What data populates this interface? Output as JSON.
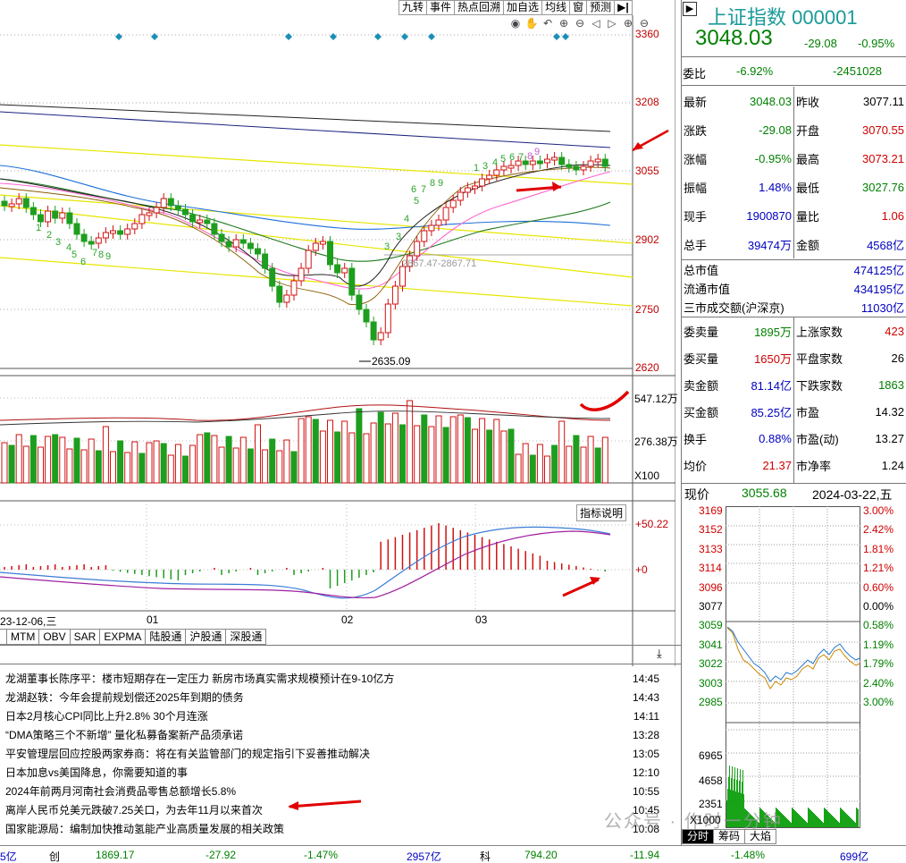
{
  "toolbar": [
    "九转",
    "事件",
    "热点回溯",
    "加自选",
    "均线",
    "窗",
    "预测"
  ],
  "price_axis": [
    "3360",
    "3208",
    "3055",
    "2902",
    "2750",
    "2620"
  ],
  "annotations": {
    "mid_label": "2867.47-2867.71",
    "low_label": "2635.09"
  },
  "volume_axis": {
    "top": "547.12万",
    "mid": "276.38万",
    "unit": "X100"
  },
  "macd": {
    "button": "指标说明",
    "top": "+50.22",
    "zero": "+0"
  },
  "date_axis": {
    "first": "23-12-06,三",
    "months": [
      "01",
      "02",
      "03"
    ]
  },
  "indicator_tabs": [
    "MTM",
    "OBV",
    "SAR",
    "EXPMA",
    "陆股通",
    "沪股通",
    "深股通"
  ],
  "news": [
    {
      "text": "龙湖董事长陈序平：楼市短期存在一定压力 新房市场真实需求规模预计在9-10亿方",
      "time": "14:45"
    },
    {
      "text": "龙湖赵轶：今年会提前规划偿还2025年到期的债务",
      "time": "14:43"
    },
    {
      "text": "日本2月核心CPI同比上升2.8% 30个月连涨",
      "time": "14:11"
    },
    {
      "text": "“DMA策略三个不新增” 量化私募备案新产品须承诺",
      "time": "13:28"
    },
    {
      "text": "平安管理层回应控股两家券商：将在有关监管部门的规定指引下妥善推动解决",
      "time": "13:05"
    },
    {
      "text": "日本加息vs美国降息，你需要知道的事",
      "time": "12:10"
    },
    {
      "text": "2024年前两月河南社会消费品零售总额增长5.8%",
      "time": "10:55"
    },
    {
      "text": "离岸人民币兑美元跌破7.25关口，为去年11月以来首次",
      "time": "10:45"
    },
    {
      "text": "国家能源局：编制加快推动氢能产业高质量发展的相关政策",
      "time": "10:08"
    }
  ],
  "quote": {
    "name": "上证指数",
    "code": "000001",
    "price": "3048.03",
    "change": "-29.08",
    "pct": "-0.95%",
    "weibi_label": "委比",
    "weibi": "-6.92%",
    "weicha": "-2451028",
    "rows": [
      [
        "最新",
        "3048.03",
        "昨收",
        "3077.11"
      ],
      [
        "涨跌",
        "-29.08",
        "开盘",
        "3070.55"
      ],
      [
        "涨幅",
        "-0.95%",
        "最高",
        "3073.21"
      ],
      [
        "振幅",
        "1.48%",
        "最低",
        "3027.76"
      ],
      [
        "现手",
        "1900870",
        "量比",
        "1.06"
      ],
      [
        "总手",
        "39474万",
        "金额",
        "4568亿"
      ]
    ],
    "mkt": [
      [
        "总市值",
        "474125亿"
      ],
      [
        "流通市值",
        "434195亿"
      ],
      [
        "三市成交额(沪深京)",
        "11030亿"
      ]
    ],
    "rows2": [
      [
        "委卖量",
        "1895万",
        "上涨家数",
        "423"
      ],
      [
        "委买量",
        "1650万",
        "平盘家数",
        "26"
      ],
      [
        "卖金额",
        "81.14亿",
        "下跌家数",
        "1863"
      ],
      [
        "买金额",
        "85.25亿",
        "市盈",
        "14.32"
      ],
      [
        "换手",
        "0.88%",
        "市盈(动)",
        "13.27"
      ],
      [
        "均价",
        "21.37",
        "市净率",
        "1.24"
      ]
    ]
  },
  "intraday": {
    "now_label": "现价",
    "now": "3055.68",
    "date": "2024-03-22,五",
    "left_axis": [
      "3169",
      "3152",
      "3133",
      "3114",
      "3096",
      "3077",
      "3059",
      "3041",
      "3022",
      "3003",
      "2985"
    ],
    "right_axis": [
      "3.00%",
      "2.42%",
      "1.81%",
      "1.21%",
      "0.60%",
      "0.00%",
      "0.58%",
      "1.19%",
      "1.79%",
      "2.40%",
      "3.00%"
    ],
    "vol_axis": [
      "6965",
      "4658",
      "2351",
      "X1000"
    ],
    "tabs": [
      "分时",
      "筹码",
      "大焰"
    ]
  },
  "statusbar": [
    "5亿",
    "创",
    "1869.17",
    "-27.92",
    "-1.47%",
    "2957亿",
    "科",
    "794.20",
    "-11.94",
    "-1.48%",
    "699亿"
  ],
  "watermark": "公众号 · 作时一分钟"
}
